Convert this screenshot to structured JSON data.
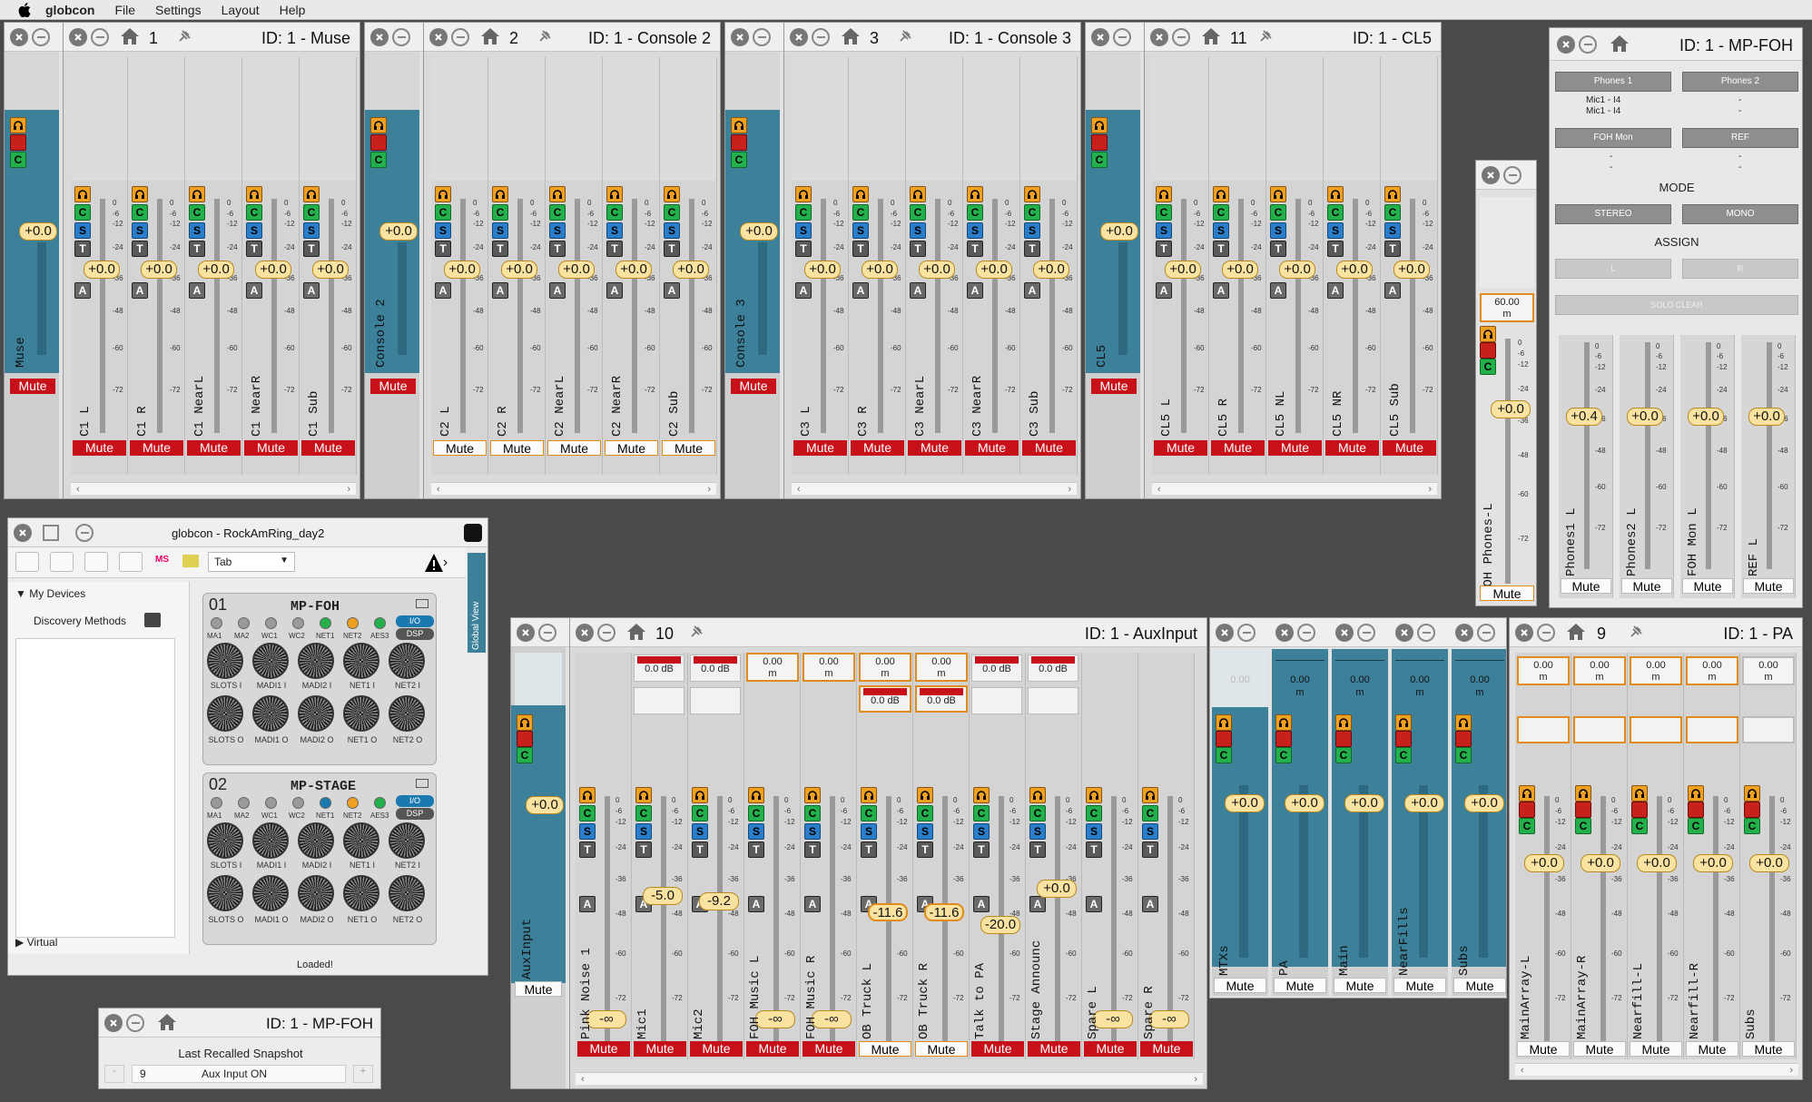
{
  "menubar": {
    "app": "globcon",
    "items": [
      "File",
      "Settings",
      "Layout",
      "Help"
    ]
  },
  "colors": {
    "mute_red": "#c8101a",
    "strip_blue": "#3c809a",
    "highlight_orange": "#e08c1c",
    "value_yellow": "#fae3a0",
    "c_green": "#23b04c",
    "s_blue": "#2a7ec9"
  },
  "icons": [
    "apple-icon",
    "close-icon",
    "minimize-icon",
    "home-icon",
    "pin-icon",
    "alert-icon",
    "global-view-icon"
  ],
  "scale": [
    "0",
    "-6",
    "-12",
    "-24",
    "-36",
    "-48",
    "-60",
    "-72"
  ],
  "common": {
    "mute": "Mute",
    "c": "C",
    "s": "S",
    "t": "T",
    "a": "A",
    "zero_gain": "+0.0",
    "zero_m": "0.00",
    "unit_m": "m",
    "zero_db": "0.0 dB",
    "faint_zero": "0.00",
    "minus_inf": "-∞"
  },
  "muse": {
    "sumLabel": "Muse",
    "num": "1",
    "id": "ID: 1 - Muse",
    "channels": [
      "C1 L",
      "C1 R",
      "C1 NearL",
      "C1 NearR",
      "C1 Sub"
    ]
  },
  "c2": {
    "sumLabel": "Console 2",
    "num": "2",
    "id": "ID: 1 - Console 2",
    "channels": [
      "C2 L",
      "C2 R",
      "C2 NearL",
      "C2 NearR",
      "C2 Sub"
    ]
  },
  "c3": {
    "sumLabel": "Console 3",
    "num": "3",
    "id": "ID: 1 - Console 3",
    "channels": [
      "C3 L",
      "C3 R",
      "C3 NearL",
      "C3 NearR",
      "C3 Sub"
    ]
  },
  "cl5": {
    "sumLabel": "CL5",
    "num": "11",
    "id": "ID: 1 - CL5",
    "channels": [
      "CL5 L",
      "CL5 R",
      "CL5 NL",
      "CL5 NR",
      "CL5 Sub"
    ]
  },
  "mpfoh": {
    "id": "ID: 1 - MP-FOH",
    "phones1": "Phones 1",
    "phones2": "Phones 2",
    "p1sub": [
      "Mic1 - I4",
      "Mic1 - I4"
    ],
    "p2sub": [
      "-",
      "-"
    ],
    "fohmon": "FOH Mon",
    "ref": "REF",
    "dashes": [
      "-",
      "-",
      "-",
      "-"
    ],
    "mode": "MODE",
    "stereo": "STEREO",
    "mono": "MONO",
    "assign": "ASSIGN",
    "l": "L",
    "r": "R",
    "soloclear": "SOLO CLEAR",
    "channels": [
      "Phones1 L",
      "Phones2 L",
      "FOH Mon L",
      "REF L"
    ],
    "gains": [
      "+0.4",
      "+0.0",
      "+0.0",
      "+0.0"
    ]
  },
  "phones": {
    "label": "FOH Phones-L",
    "delay": "60.00",
    "unit": "m",
    "gain": "+0.0"
  },
  "globcon": {
    "title": "globcon - RockAmRing_day2",
    "tab": "Tab",
    "mydevices": "My Devices",
    "discovery": "Discovery Methods",
    "virtual": "Virtual",
    "globalview": "Global View",
    "loaded": "Loaded!",
    "ms": "MS",
    "devices": [
      {
        "num": "01",
        "name": "MP-FOH",
        "leds": [
          "MA1",
          "MA2",
          "WC1",
          "WC2",
          "NET1",
          "NET2",
          "AES3"
        ],
        "io": "I/O",
        "dsp": "DSP",
        "knobsI": [
          "SLOTS I",
          "MADI1 I",
          "MADI2 I",
          "NET1 I",
          "NET2 I"
        ],
        "knobsO": [
          "SLOTS O",
          "MADI1 O",
          "MADI2 O",
          "NET1 O",
          "NET2 O"
        ]
      },
      {
        "num": "02",
        "name": "MP-STAGE",
        "leds": [
          "MA1",
          "MA2",
          "WC1",
          "WC2",
          "NET1",
          "NET2",
          "AES3"
        ],
        "io": "I/O",
        "dsp": "DSP",
        "knobsI": [
          "SLOTS I",
          "MADI1 I",
          "MADI2 I",
          "NET1 I",
          "NET2 I"
        ],
        "knobsO": [
          "SLOTS O",
          "MADI1 O",
          "MADI2 O",
          "NET1 O",
          "NET2 O"
        ]
      }
    ]
  },
  "snapshot": {
    "id": "ID: 1 - MP-FOH",
    "title": "Last Recalled Snapshot",
    "minus": "-",
    "num": "9",
    "name": "Aux Input ON",
    "plus": "+"
  },
  "auxinput": {
    "sumLabel": "AuxInput",
    "num": "10",
    "id": "ID: 1 - AuxInput",
    "channels": [
      "Pink Noise 1",
      "Mic1",
      "Mic2",
      "FOH Music L",
      "FOH Music R",
      "OB Truck L",
      "OB Truck R",
      "Talk to PA",
      "Stage Announc",
      "Spare L",
      "Spare R"
    ],
    "gains": [
      "-∞",
      "-5.0",
      "-9.2",
      "-∞",
      "-∞",
      "-11.6",
      "-11.6",
      "-20.0",
      "+0.0",
      "-∞",
      "-∞"
    ],
    "topDb": [
      "0.0 dB",
      "0.0 dB",
      "0.0 dB",
      "0.0 dB",
      "0.0 dB",
      "0.0 dB",
      "0.0 dB",
      "0.0 dB"
    ]
  },
  "aux2": {
    "groups": [
      "MTXs",
      "PA",
      "Main",
      "NearFills",
      "Subs"
    ]
  },
  "pa": {
    "num": "9",
    "id": "ID: 1 - PA",
    "channels": [
      "MainArray-L",
      "MainArray-R",
      "Nearfill-L",
      "Nearfill-R",
      "Subs"
    ]
  }
}
